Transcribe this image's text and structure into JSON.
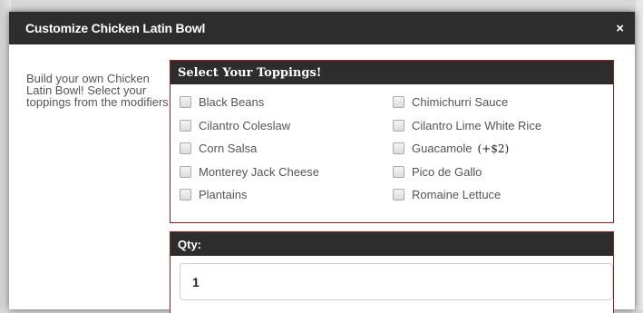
{
  "modal": {
    "title": "Customize Chicken Latin Bowl",
    "close_symbol": "×",
    "description": "Build your own Chicken Latin Bowl! Select your toppings from the modifiers"
  },
  "toppings": {
    "header": "Select Your Toppings!",
    "options": [
      {
        "label": "Black Beans",
        "price": ""
      },
      {
        "label": "Chimichurri Sauce",
        "price": ""
      },
      {
        "label": "Cilantro Coleslaw",
        "price": ""
      },
      {
        "label": "Cilantro Lime White Rice",
        "price": ""
      },
      {
        "label": "Corn Salsa",
        "price": ""
      },
      {
        "label": "Guacamole",
        "price": "(+$2)"
      },
      {
        "label": "Monterey Jack Cheese",
        "price": ""
      },
      {
        "label": "Pico de Gallo",
        "price": ""
      },
      {
        "label": "Plantains",
        "price": ""
      },
      {
        "label": "Romaine Lettuce",
        "price": ""
      }
    ]
  },
  "qty": {
    "header": "Qty:",
    "value": "1"
  }
}
